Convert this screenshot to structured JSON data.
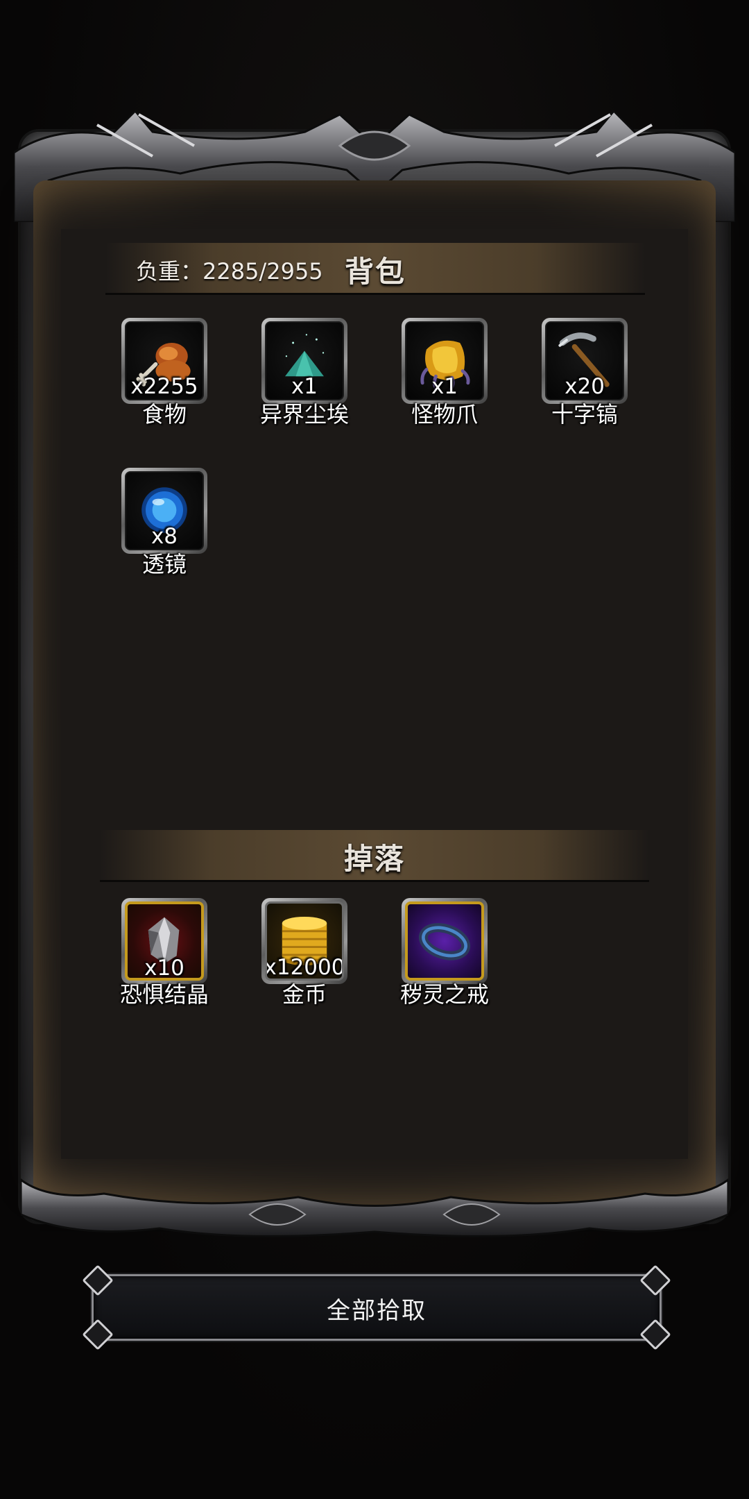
{
  "backpack": {
    "title": "背包",
    "weight_label": "负重：2285/2955",
    "items": [
      {
        "name": "食物",
        "qty": "x2255",
        "icon": "drumstick-icon"
      },
      {
        "name": "异界尘埃",
        "qty": "x1",
        "icon": "dust-pile-icon"
      },
      {
        "name": "怪物爪",
        "qty": "x1",
        "icon": "claw-icon"
      },
      {
        "name": "十字镐",
        "qty": "x20",
        "icon": "pickaxe-icon"
      },
      {
        "name": "透镜",
        "qty": "x8",
        "icon": "lens-orb-icon"
      }
    ]
  },
  "drops": {
    "title": "掉落",
    "items": [
      {
        "name": "恐惧结晶",
        "qty": "x10",
        "icon": "fear-crystal-icon"
      },
      {
        "name": "金币",
        "qty": "x12000",
        "icon": "gold-coins-icon"
      },
      {
        "name": "秽灵之戒",
        "qty": "",
        "icon": "ring-icon"
      }
    ]
  },
  "actions": {
    "pickup_all": "全部拾取"
  },
  "colors": {
    "parchment": "#5b4a33",
    "panel": "#1c1917",
    "slot_border_gold": "#c59a1d",
    "text": "#ffffff"
  }
}
